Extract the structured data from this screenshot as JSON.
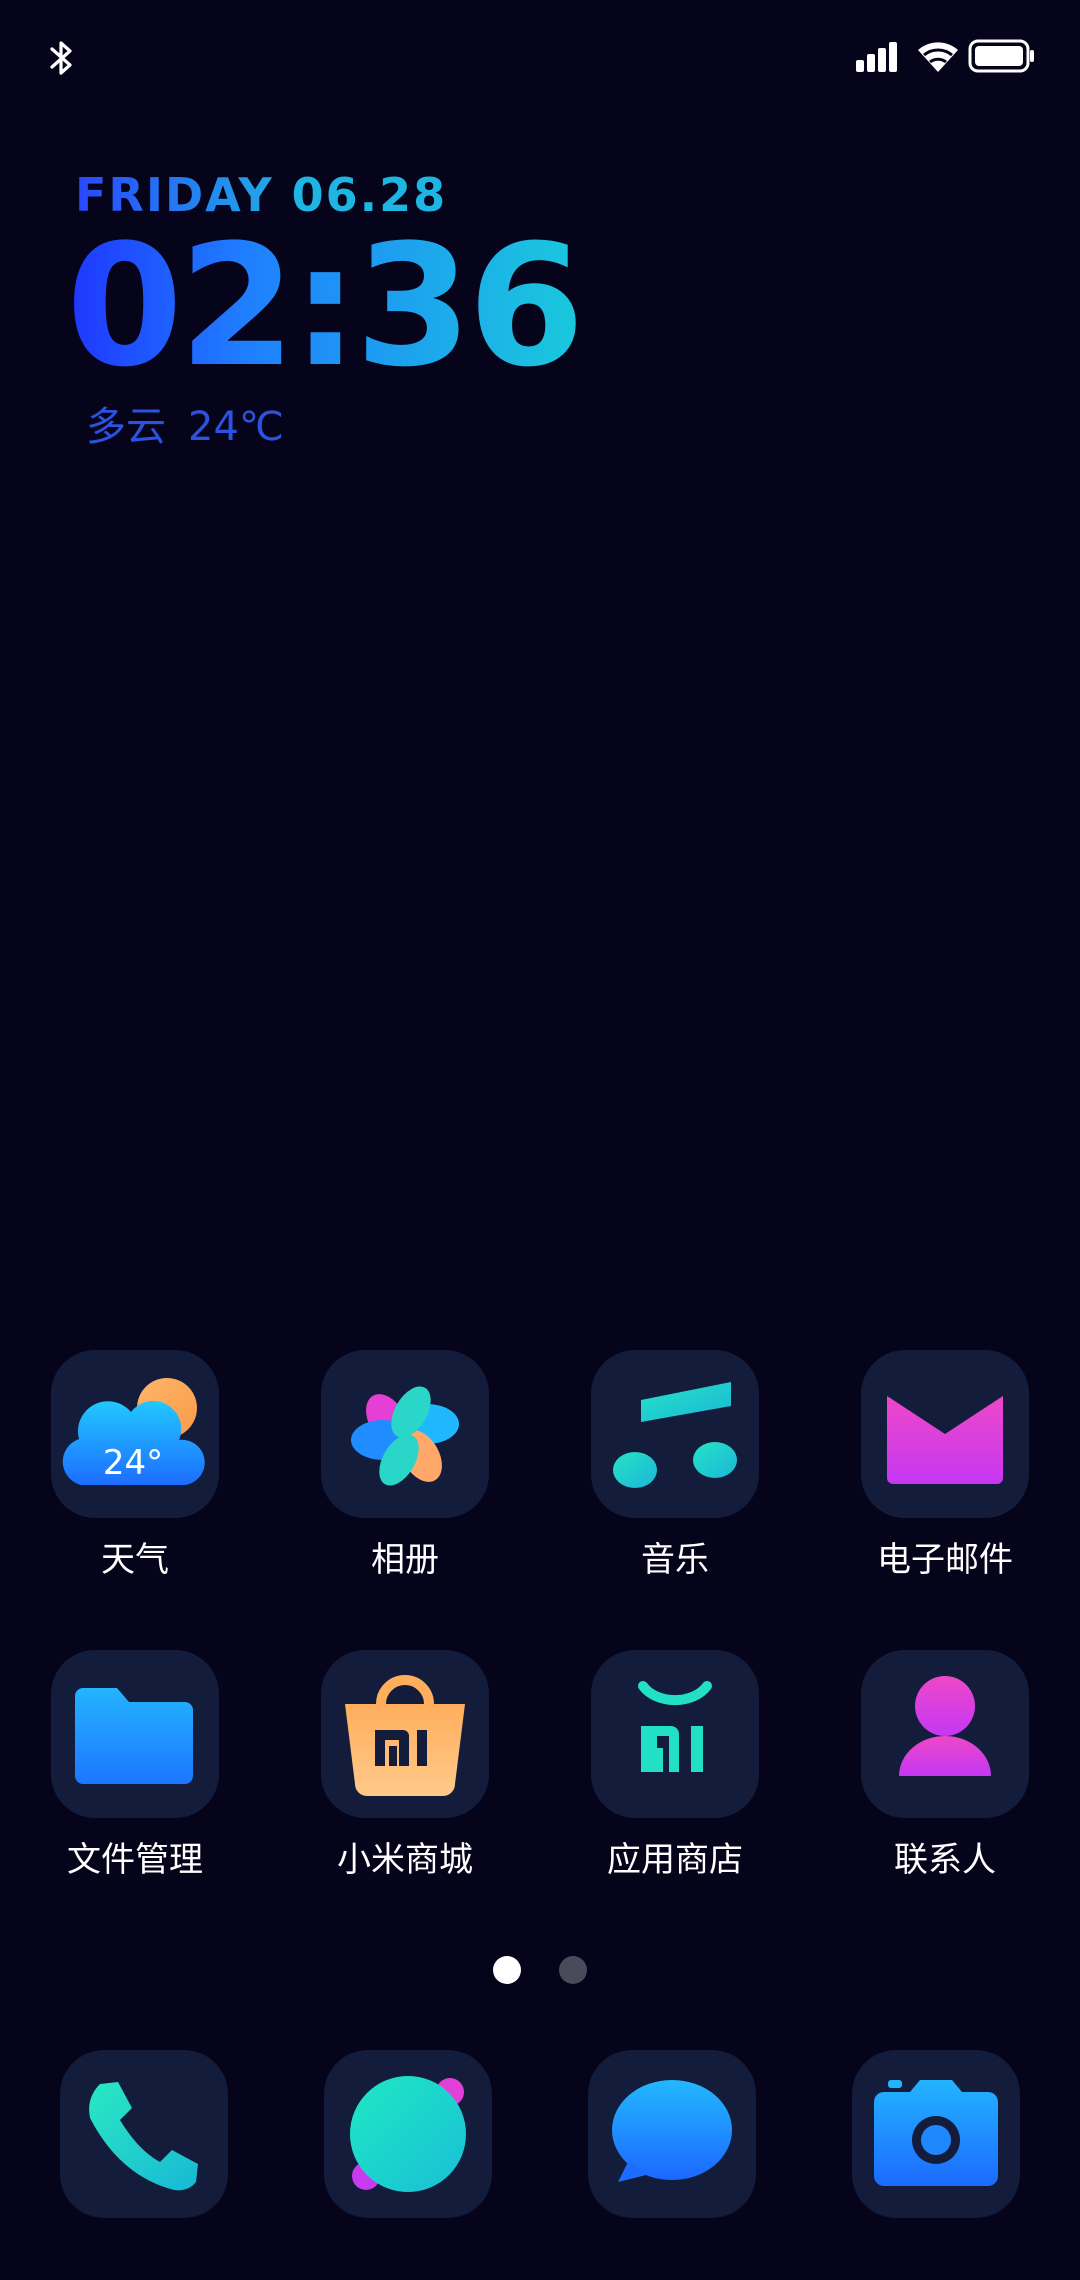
{
  "clock": {
    "date": "FRIDAY 06.28",
    "time": "02:36",
    "weather_condition": "多云",
    "temperature": "24℃"
  },
  "apps": {
    "weather": {
      "label": "天气",
      "badge": "24°"
    },
    "gallery": {
      "label": "相册"
    },
    "music": {
      "label": "音乐"
    },
    "email": {
      "label": "电子邮件"
    },
    "files": {
      "label": "文件管理"
    },
    "mi_store": {
      "label": "小米商城"
    },
    "app_store": {
      "label": "应用商店"
    },
    "contacts": {
      "label": "联系人"
    }
  },
  "pager": {
    "current": 1,
    "total": 2
  },
  "dock": [
    {
      "icon": "phone-icon"
    },
    {
      "icon": "browser-icon"
    },
    {
      "icon": "messages-icon"
    },
    {
      "icon": "camera-icon"
    }
  ],
  "colors": {
    "background": "#05041a",
    "tile": "#131c3a",
    "accent_blue": "#1f36ff",
    "accent_cyan": "#1ac9dc"
  }
}
